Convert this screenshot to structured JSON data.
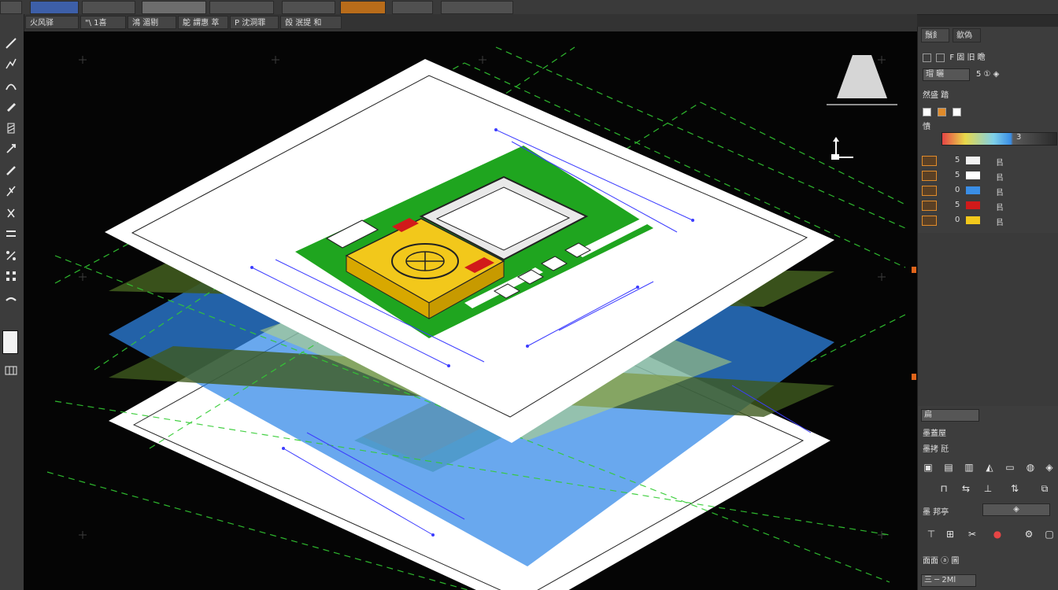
{
  "app": {
    "tabs": [
      "火风驿",
      "\"\\ 1喜",
      "鴻 湄剔",
      "鴕 謂惠 萃",
      "P 沈洞罪",
      "㲃 泯提 和"
    ]
  },
  "viewport": {
    "background": "#050505",
    "accent_colors": {
      "paper": "#ffffff",
      "site_green": "#1fa51f",
      "building_yellow": "#f2c81b",
      "building_red": "#d11a1a",
      "water_blue": "#3a8ee6",
      "dimension_blue": "#3c3cff",
      "grid_green": "#33cc33"
    },
    "icons": [
      "viewcube-icon",
      "ucs-axis-icon"
    ]
  },
  "right_panel": {
    "tabs": [
      "鬚飠",
      "歙偽"
    ],
    "row1_label": "F 固 旧 瞻",
    "row2_button": "瑁 曬",
    "row2_extra": "5 ① ◈",
    "section_label": "然盛 踏",
    "section2_label": "憒",
    "color_value": "3",
    "layers": [
      {
        "num": "5",
        "label": "㠯"
      },
      {
        "num": "5",
        "label": "㠯"
      },
      {
        "num": "0",
        "label": "㠯"
      },
      {
        "num": "5",
        "label": "㠯"
      },
      {
        "num": "0",
        "label": "㠯"
      }
    ],
    "bottom_tab": "扁",
    "prop_title": "墨蓋屋",
    "prop_row": "墨拷 瓩",
    "dropdown_label": "墨 邦亭",
    "dropdown_value": "◈",
    "footer_label": "面面 ⓐ 圖",
    "footer_status": "三 ─ 2Ml"
  }
}
